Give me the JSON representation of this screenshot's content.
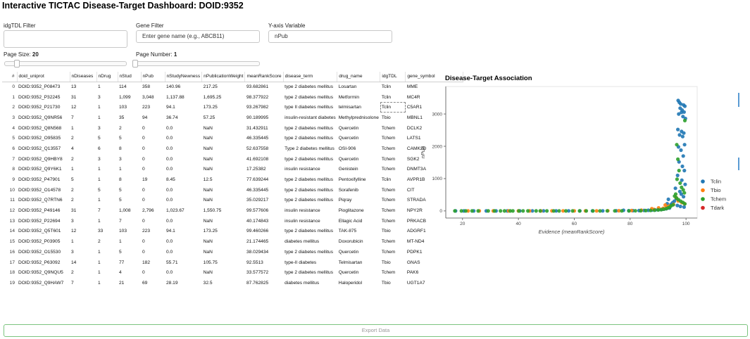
{
  "app": {
    "title": "Interactive TICTAC Disease-Target Dashboard: DOID:9352"
  },
  "filters": {
    "idg_label": "idgTDL Filter",
    "gene_label": "Gene Filter",
    "gene_placeholder": "Enter gene name (e.g., ABCB11)",
    "yaxis_label": "Y-axis Variable",
    "yaxis_value": "nPub"
  },
  "sliders": {
    "page_size_label": "Page Size: ",
    "page_size_value": "20",
    "page_size_fraction": 0.0,
    "page_number_label": "Page Number: ",
    "page_number_value": "1",
    "page_number_fraction": 0.0
  },
  "table": {
    "columns": [
      "#",
      "doid_uniprot",
      "nDiseases",
      "nDrug",
      "nStud",
      "nPub",
      "nStudyNewness",
      "nPublicationWeight",
      "meanRankScore",
      "disease_term",
      "drug_name",
      "idgTDL",
      "gene_symbol"
    ],
    "rows": [
      [
        "0",
        "DOID:9352_P08473",
        "13",
        "1",
        "114",
        "358",
        "140.96",
        "217.25",
        "93.682861",
        "type 2 diabetes mellitus",
        "Losartan",
        "Tclin",
        "MME"
      ],
      [
        "1",
        "DOID:9352_P32245",
        "31",
        "3",
        "1,099",
        "3,048",
        "1,137.88",
        "1,695.25",
        "98.377922",
        "type 2 diabetes mellitus",
        "Metformin",
        "Tclin",
        "MC4R"
      ],
      [
        "2",
        "DOID:9352_P21730",
        "12",
        "1",
        "103",
        "223",
        "94.1",
        "173.25",
        "93.267982",
        "type II diabetes mellitus",
        "telmisartan",
        "Tclin",
        "C5AR1"
      ],
      [
        "3",
        "DOID:9352_Q9NR56",
        "7",
        "1",
        "35",
        "94",
        "36.74",
        "57.25",
        "90.189995",
        "insulin-resistant diabetes",
        "Methylprednisolone",
        "Tbio",
        "MBNL1"
      ],
      [
        "4",
        "DOID:9352_Q8N568",
        "1",
        "3",
        "2",
        "0",
        "0.0",
        "NaN",
        "31.432911",
        "type 2 diabetes mellitus",
        "Quercetin",
        "Tchem",
        "DCLK2"
      ],
      [
        "5",
        "DOID:9352_O95835",
        "2",
        "5",
        "5",
        "0",
        "0.0",
        "NaN",
        "46.335445",
        "type 2 diabetes mellitus",
        "Quercetin",
        "Tchem",
        "LATS1"
      ],
      [
        "6",
        "DOID:9352_Q13557",
        "4",
        "6",
        "8",
        "0",
        "0.0",
        "NaN",
        "52.637558",
        "Type 2 diabetes mellitus",
        "OSI-906",
        "Tchem",
        "CAMK2D"
      ],
      [
        "7",
        "DOID:9352_Q9HBY8",
        "2",
        "3",
        "3",
        "0",
        "0.0",
        "NaN",
        "41.692108",
        "type 2 diabetes mellitus",
        "Quercetin",
        "Tchem",
        "SGK2"
      ],
      [
        "8",
        "DOID:9352_Q9Y6K1",
        "1",
        "1",
        "1",
        "0",
        "0.0",
        "NaN",
        "17.25382",
        "insulin resistance",
        "Genistein",
        "Tchem",
        "DNMT3A"
      ],
      [
        "9",
        "DOID:9352_P47901",
        "5",
        "1",
        "8",
        "19",
        "8.45",
        "12.5",
        "77.639244",
        "type 2 diabetes mellitus",
        "Pentoxifylline",
        "Tclin",
        "AVPR1B"
      ],
      [
        "10",
        "DOID:9352_O14578",
        "2",
        "5",
        "5",
        "0",
        "0.0",
        "NaN",
        "46.335445",
        "type 2 diabetes mellitus",
        "Sorafenib",
        "Tchem",
        "CIT"
      ],
      [
        "11",
        "DOID:9352_Q7RTN6",
        "2",
        "1",
        "5",
        "0",
        "0.0",
        "NaN",
        "35.029217",
        "type 2 diabetes mellitus",
        "Piqray",
        "Tchem",
        "STRADA"
      ],
      [
        "12",
        "DOID:9352_P49146",
        "31",
        "7",
        "1,008",
        "2,796",
        "1,023.67",
        "1,550.75",
        "99.577606",
        "insulin resistance",
        "Pioglitazone",
        "Tchem",
        "NPY2R"
      ],
      [
        "13",
        "DOID:9352_P22694",
        "3",
        "1",
        "7",
        "0",
        "0.0",
        "NaN",
        "40.174843",
        "insulin resistance",
        "Ellagic Acid",
        "Tchem",
        "PRKACB"
      ],
      [
        "14",
        "DOID:9352_Q5T601",
        "12",
        "33",
        "103",
        "223",
        "94.1",
        "173.25",
        "99.460266",
        "type 2 diabetes mellitus",
        "TAK-875",
        "Tbio",
        "ADGRF1"
      ],
      [
        "15",
        "DOID:9352_P03905",
        "1",
        "2",
        "1",
        "0",
        "0.0",
        "NaN",
        "21.174465",
        "diabetes mellitus",
        "Doxorubicin",
        "Tchem",
        "MT-ND4"
      ],
      [
        "16",
        "DOID:9352_O15530",
        "3",
        "1",
        "5",
        "0",
        "0.0",
        "NaN",
        "38.029434",
        "type 2 diabetes mellitus",
        "Quercetin",
        "Tchem",
        "PDPK1"
      ],
      [
        "17",
        "DOID:9352_P63092",
        "14",
        "1",
        "77",
        "182",
        "55.71",
        "105.75",
        "92.5513",
        "type-II diabetes",
        "Telmisartan",
        "Tbio",
        "GNAS"
      ],
      [
        "18",
        "DOID:9352_Q9NQU5",
        "2",
        "1",
        "4",
        "0",
        "0.0",
        "NaN",
        "33.577572",
        "type 2 diabetes mellitus",
        "Quercetin",
        "Tchem",
        "PAK6"
      ],
      [
        "19",
        "DOID:9352_Q9HAW7",
        "7",
        "1",
        "21",
        "69",
        "28.19",
        "32.5",
        "87.762825",
        "diabetes mellitus",
        "Haloperidol",
        "Tbio",
        "UGT1A7"
      ]
    ]
  },
  "chart_data": {
    "type": "scatter",
    "title": "Disease-Target Association",
    "xlabel": "Evidence (meanRankScore)",
    "ylabel": "nPub",
    "xlim": [
      14,
      104
    ],
    "ylim": [
      -220,
      3850
    ],
    "xticks": [
      20,
      40,
      60,
      80,
      100
    ],
    "yticks": [
      0,
      1000,
      2000,
      3000
    ],
    "legend_position": "right",
    "series": [
      {
        "name": "Tclin",
        "color": "#1f77b4",
        "points": [
          [
            93.68,
            358
          ],
          [
            98.38,
            3048
          ],
          [
            93.27,
            223
          ],
          [
            77.64,
            19
          ],
          [
            97.2,
            3420
          ],
          [
            97.6,
            3360
          ],
          [
            98.1,
            3310
          ],
          [
            99.1,
            3280
          ],
          [
            99.6,
            3240
          ],
          [
            97.9,
            3180
          ],
          [
            98.6,
            3120
          ],
          [
            99.3,
            3060
          ],
          [
            97.4,
            3000
          ],
          [
            98.9,
            2920
          ],
          [
            99.8,
            2860
          ],
          [
            97.1,
            2520
          ],
          [
            98.4,
            2460
          ],
          [
            99.2,
            2410
          ],
          [
            97.7,
            2350
          ],
          [
            98.8,
            2300
          ],
          [
            99.5,
            2050
          ],
          [
            97.3,
            1980
          ],
          [
            98.2,
            1880
          ],
          [
            99.0,
            1700
          ],
          [
            97.5,
            1520
          ],
          [
            98.7,
            1380
          ],
          [
            99.4,
            1250
          ],
          [
            97.0,
            1100
          ],
          [
            98.5,
            950
          ],
          [
            99.7,
            820
          ],
          [
            96.2,
            700
          ],
          [
            97.8,
            600
          ],
          [
            98.3,
            520
          ],
          [
            99.1,
            440
          ],
          [
            96.5,
            380
          ],
          [
            95.8,
            300
          ],
          [
            95.2,
            250
          ],
          [
            94.6,
            200
          ],
          [
            96.9,
            170
          ],
          [
            98.0,
            140
          ],
          [
            99.3,
            120
          ],
          [
            94.1,
            90
          ],
          [
            93.0,
            70
          ],
          [
            92.2,
            60
          ],
          [
            91.4,
            50
          ],
          [
            90.2,
            40
          ],
          [
            89.0,
            30
          ],
          [
            87.8,
            25
          ],
          [
            86.5,
            20
          ],
          [
            85.0,
            15
          ],
          [
            83.2,
            10
          ],
          [
            81.0,
            8
          ],
          [
            79.5,
            6
          ],
          [
            75.0,
            4
          ],
          [
            70.2,
            3
          ],
          [
            66.5,
            2
          ],
          [
            62.0,
            2
          ],
          [
            58.0,
            1
          ],
          [
            53.5,
            1
          ],
          [
            49.0,
            1
          ],
          [
            45.0,
            1
          ],
          [
            40.5,
            0
          ],
          [
            36.0,
            0
          ],
          [
            32.0,
            0
          ],
          [
            28.5,
            0
          ],
          [
            24.0,
            0
          ],
          [
            20.5,
            0
          ],
          [
            17.5,
            0
          ]
        ]
      },
      {
        "name": "Tbio",
        "color": "#ff7f0e",
        "points": [
          [
            90.19,
            94
          ],
          [
            99.46,
            223
          ],
          [
            92.55,
            182
          ],
          [
            87.76,
            69
          ],
          [
            96.4,
            420
          ],
          [
            97.2,
            310
          ],
          [
            98.5,
            260
          ],
          [
            95.5,
            200
          ],
          [
            94.0,
            150
          ],
          [
            93.1,
            120
          ],
          [
            91.8,
            80
          ],
          [
            88.6,
            45
          ],
          [
            84.0,
            22
          ],
          [
            80.5,
            12
          ],
          [
            76.0,
            6
          ],
          [
            72.0,
            4
          ],
          [
            68.0,
            3
          ],
          [
            64.0,
            2
          ],
          [
            60.0,
            1
          ],
          [
            56.0,
            1
          ],
          [
            52.0,
            1
          ],
          [
            48.0,
            0
          ],
          [
            44.0,
            0
          ],
          [
            40.0,
            0
          ],
          [
            36.5,
            0
          ],
          [
            31.0,
            0
          ],
          [
            26.0,
            0
          ],
          [
            22.0,
            0
          ]
        ]
      },
      {
        "name": "Tchem",
        "color": "#2ca02c",
        "points": [
          [
            31.43,
            0
          ],
          [
            46.34,
            0
          ],
          [
            52.64,
            0
          ],
          [
            41.69,
            0
          ],
          [
            17.25,
            0
          ],
          [
            35.03,
            0
          ],
          [
            99.58,
            2796
          ],
          [
            40.17,
            0
          ],
          [
            21.17,
            0
          ],
          [
            38.03,
            0
          ],
          [
            33.58,
            0
          ],
          [
            96.7,
            2050
          ],
          [
            97.1,
            1600
          ],
          [
            97.5,
            1250
          ],
          [
            96.8,
            980
          ],
          [
            97.9,
            860
          ],
          [
            98.4,
            730
          ],
          [
            99.0,
            650
          ],
          [
            99.4,
            560
          ],
          [
            96.3,
            520
          ],
          [
            95.9,
            460
          ],
          [
            96.6,
            400
          ],
          [
            97.3,
            350
          ],
          [
            98.1,
            300
          ],
          [
            98.9,
            260
          ],
          [
            99.6,
            220
          ],
          [
            95.4,
            190
          ],
          [
            94.7,
            160
          ],
          [
            94.2,
            120
          ],
          [
            93.6,
            95
          ],
          [
            92.9,
            70
          ],
          [
            92.0,
            55
          ],
          [
            91.1,
            40
          ],
          [
            90.0,
            30
          ],
          [
            88.7,
            22
          ],
          [
            87.3,
            15
          ],
          [
            85.6,
            10
          ],
          [
            83.8,
            6
          ],
          [
            81.9,
            4
          ],
          [
            79.6,
            3
          ],
          [
            77.0,
            2
          ],
          [
            74.5,
            1
          ],
          [
            71.8,
            1
          ],
          [
            69.2,
            0
          ],
          [
            66.7,
            0
          ],
          [
            64.3,
            0
          ],
          [
            61.9,
            0
          ],
          [
            59.4,
            0
          ],
          [
            57.0,
            0
          ],
          [
            54.6,
            0
          ],
          [
            50.2,
            0
          ],
          [
            47.8,
            0
          ],
          [
            43.4,
            0
          ],
          [
            37.1,
            0
          ],
          [
            29.2,
            0
          ],
          [
            25.6,
            0
          ],
          [
            23.4,
            0
          ],
          [
            19.6,
            0
          ]
        ]
      },
      {
        "name": "Tdark",
        "color": "#d62728",
        "points": []
      }
    ]
  }
}
